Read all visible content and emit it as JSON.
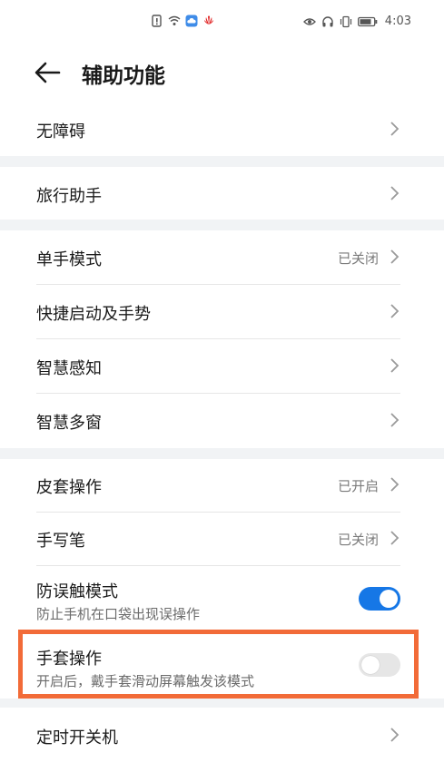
{
  "status_bar": {
    "left_icons": [
      "sim-alert-icon",
      "wifi-icon",
      "cloud-icon",
      "huawei-icon"
    ],
    "right_icons": [
      "eye-icon",
      "headset-icon",
      "vibrate-icon",
      "battery-icon"
    ],
    "time": "4:03"
  },
  "header": {
    "back_icon": "arrow-left-icon",
    "title": "辅助功能"
  },
  "groups": [
    {
      "items": [
        {
          "label": "无障碍"
        }
      ]
    },
    {
      "items": [
        {
          "label": "旅行助手"
        }
      ]
    },
    {
      "items": [
        {
          "label": "单手模式",
          "value": "已关闭"
        },
        {
          "label": "快捷启动及手势"
        },
        {
          "label": "智慧感知"
        },
        {
          "label": "智慧多窗"
        }
      ]
    },
    {
      "items": [
        {
          "label": "皮套操作",
          "value": "已开启"
        },
        {
          "label": "手写笔",
          "value": "已关闭"
        },
        {
          "label": "防误触模式",
          "subtitle": "防止手机在口袋出现误操作",
          "toggle": true
        },
        {
          "label": "手套操作",
          "subtitle": "开启后，戴手套滑动屏幕触发该模式",
          "toggle": false
        }
      ]
    },
    {
      "items": [
        {
          "label": "定时开关机"
        }
      ]
    }
  ],
  "colors": {
    "accent": "#1677e6",
    "highlight": "#f26b38",
    "separator": "#f1f3f5"
  }
}
